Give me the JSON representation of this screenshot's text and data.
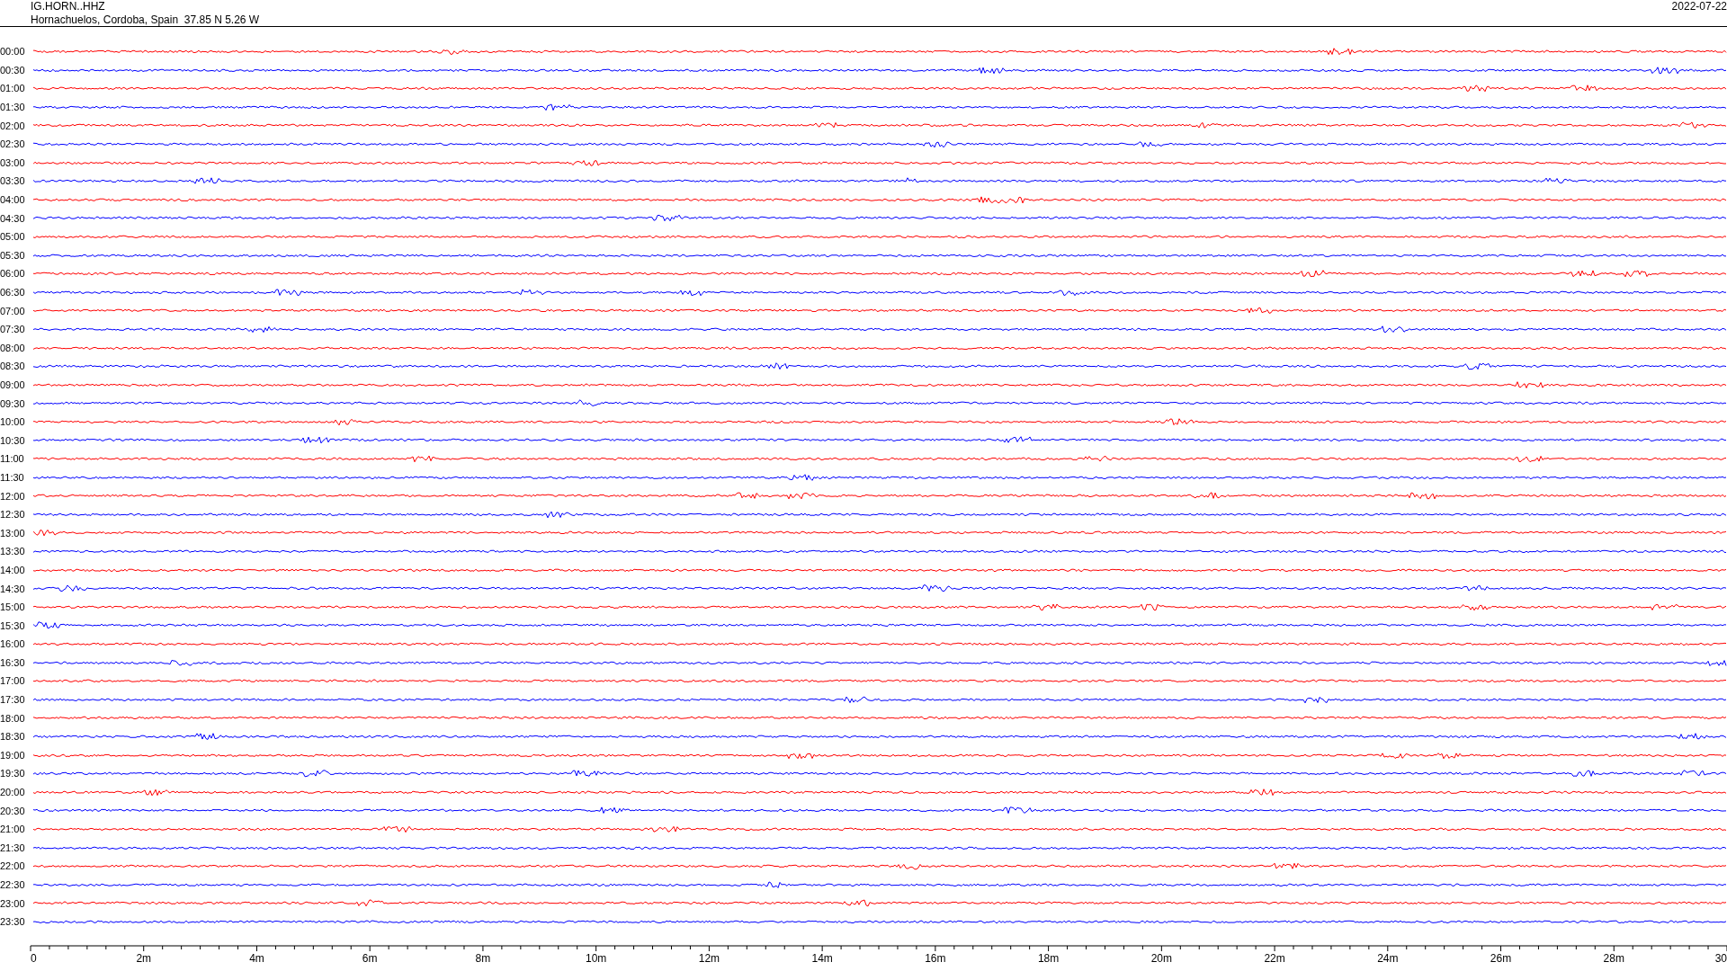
{
  "header": {
    "station": "IG.HORN..HHZ",
    "location": "Hornachuelos, Cordoba, Spain  37.85 N 5.26 W",
    "date": "2022-07-22"
  },
  "rows": [
    {
      "time": "00:00",
      "color": "#ff0000"
    },
    {
      "time": "00:30",
      "color": "#0000ff"
    },
    {
      "time": "01:00",
      "color": "#ff0000"
    },
    {
      "time": "01:30",
      "color": "#0000ff"
    },
    {
      "time": "02:00",
      "color": "#ff0000"
    },
    {
      "time": "02:30",
      "color": "#0000ff"
    },
    {
      "time": "03:00",
      "color": "#ff0000"
    },
    {
      "time": "03:30",
      "color": "#0000ff"
    },
    {
      "time": "04:00",
      "color": "#ff0000"
    },
    {
      "time": "04:30",
      "color": "#0000ff"
    },
    {
      "time": "05:00",
      "color": "#ff0000"
    },
    {
      "time": "05:30",
      "color": "#0000ff"
    },
    {
      "time": "06:00",
      "color": "#ff0000"
    },
    {
      "time": "06:30",
      "color": "#0000ff"
    },
    {
      "time": "07:00",
      "color": "#ff0000"
    },
    {
      "time": "07:30",
      "color": "#0000ff"
    },
    {
      "time": "08:00",
      "color": "#ff0000"
    },
    {
      "time": "08:30",
      "color": "#0000ff"
    },
    {
      "time": "09:00",
      "color": "#ff0000"
    },
    {
      "time": "09:30",
      "color": "#0000ff"
    },
    {
      "time": "10:00",
      "color": "#ff0000"
    },
    {
      "time": "10:30",
      "color": "#0000ff"
    },
    {
      "time": "11:00",
      "color": "#ff0000"
    },
    {
      "time": "11:30",
      "color": "#0000ff"
    },
    {
      "time": "12:00",
      "color": "#ff0000"
    },
    {
      "time": "12:30",
      "color": "#0000ff"
    },
    {
      "time": "13:00",
      "color": "#ff0000"
    },
    {
      "time": "13:30",
      "color": "#0000ff"
    },
    {
      "time": "14:00",
      "color": "#ff0000"
    },
    {
      "time": "14:30",
      "color": "#0000ff"
    },
    {
      "time": "15:00",
      "color": "#ff0000"
    },
    {
      "time": "15:30",
      "color": "#0000ff"
    },
    {
      "time": "16:00",
      "color": "#ff0000"
    },
    {
      "time": "16:30",
      "color": "#0000ff"
    },
    {
      "time": "17:00",
      "color": "#ff0000"
    },
    {
      "time": "17:30",
      "color": "#0000ff"
    },
    {
      "time": "18:00",
      "color": "#ff0000"
    },
    {
      "time": "18:30",
      "color": "#0000ff"
    },
    {
      "time": "19:00",
      "color": "#ff0000"
    },
    {
      "time": "19:30",
      "color": "#0000ff"
    },
    {
      "time": "20:00",
      "color": "#ff0000"
    },
    {
      "time": "20:30",
      "color": "#0000ff"
    },
    {
      "time": "21:00",
      "color": "#ff0000"
    },
    {
      "time": "21:30",
      "color": "#0000ff"
    },
    {
      "time": "22:00",
      "color": "#ff0000"
    },
    {
      "time": "22:30",
      "color": "#0000ff"
    },
    {
      "time": "23:00",
      "color": "#ff0000"
    },
    {
      "time": "23:30",
      "color": "#0000ff"
    }
  ],
  "x_axis": {
    "labels": [
      "0",
      "2m",
      "4m",
      "6m",
      "8m",
      "10m",
      "12m",
      "14m",
      "16m",
      "18m",
      "20m",
      "22m",
      "24m",
      "26m",
      "28m",
      "30"
    ]
  }
}
